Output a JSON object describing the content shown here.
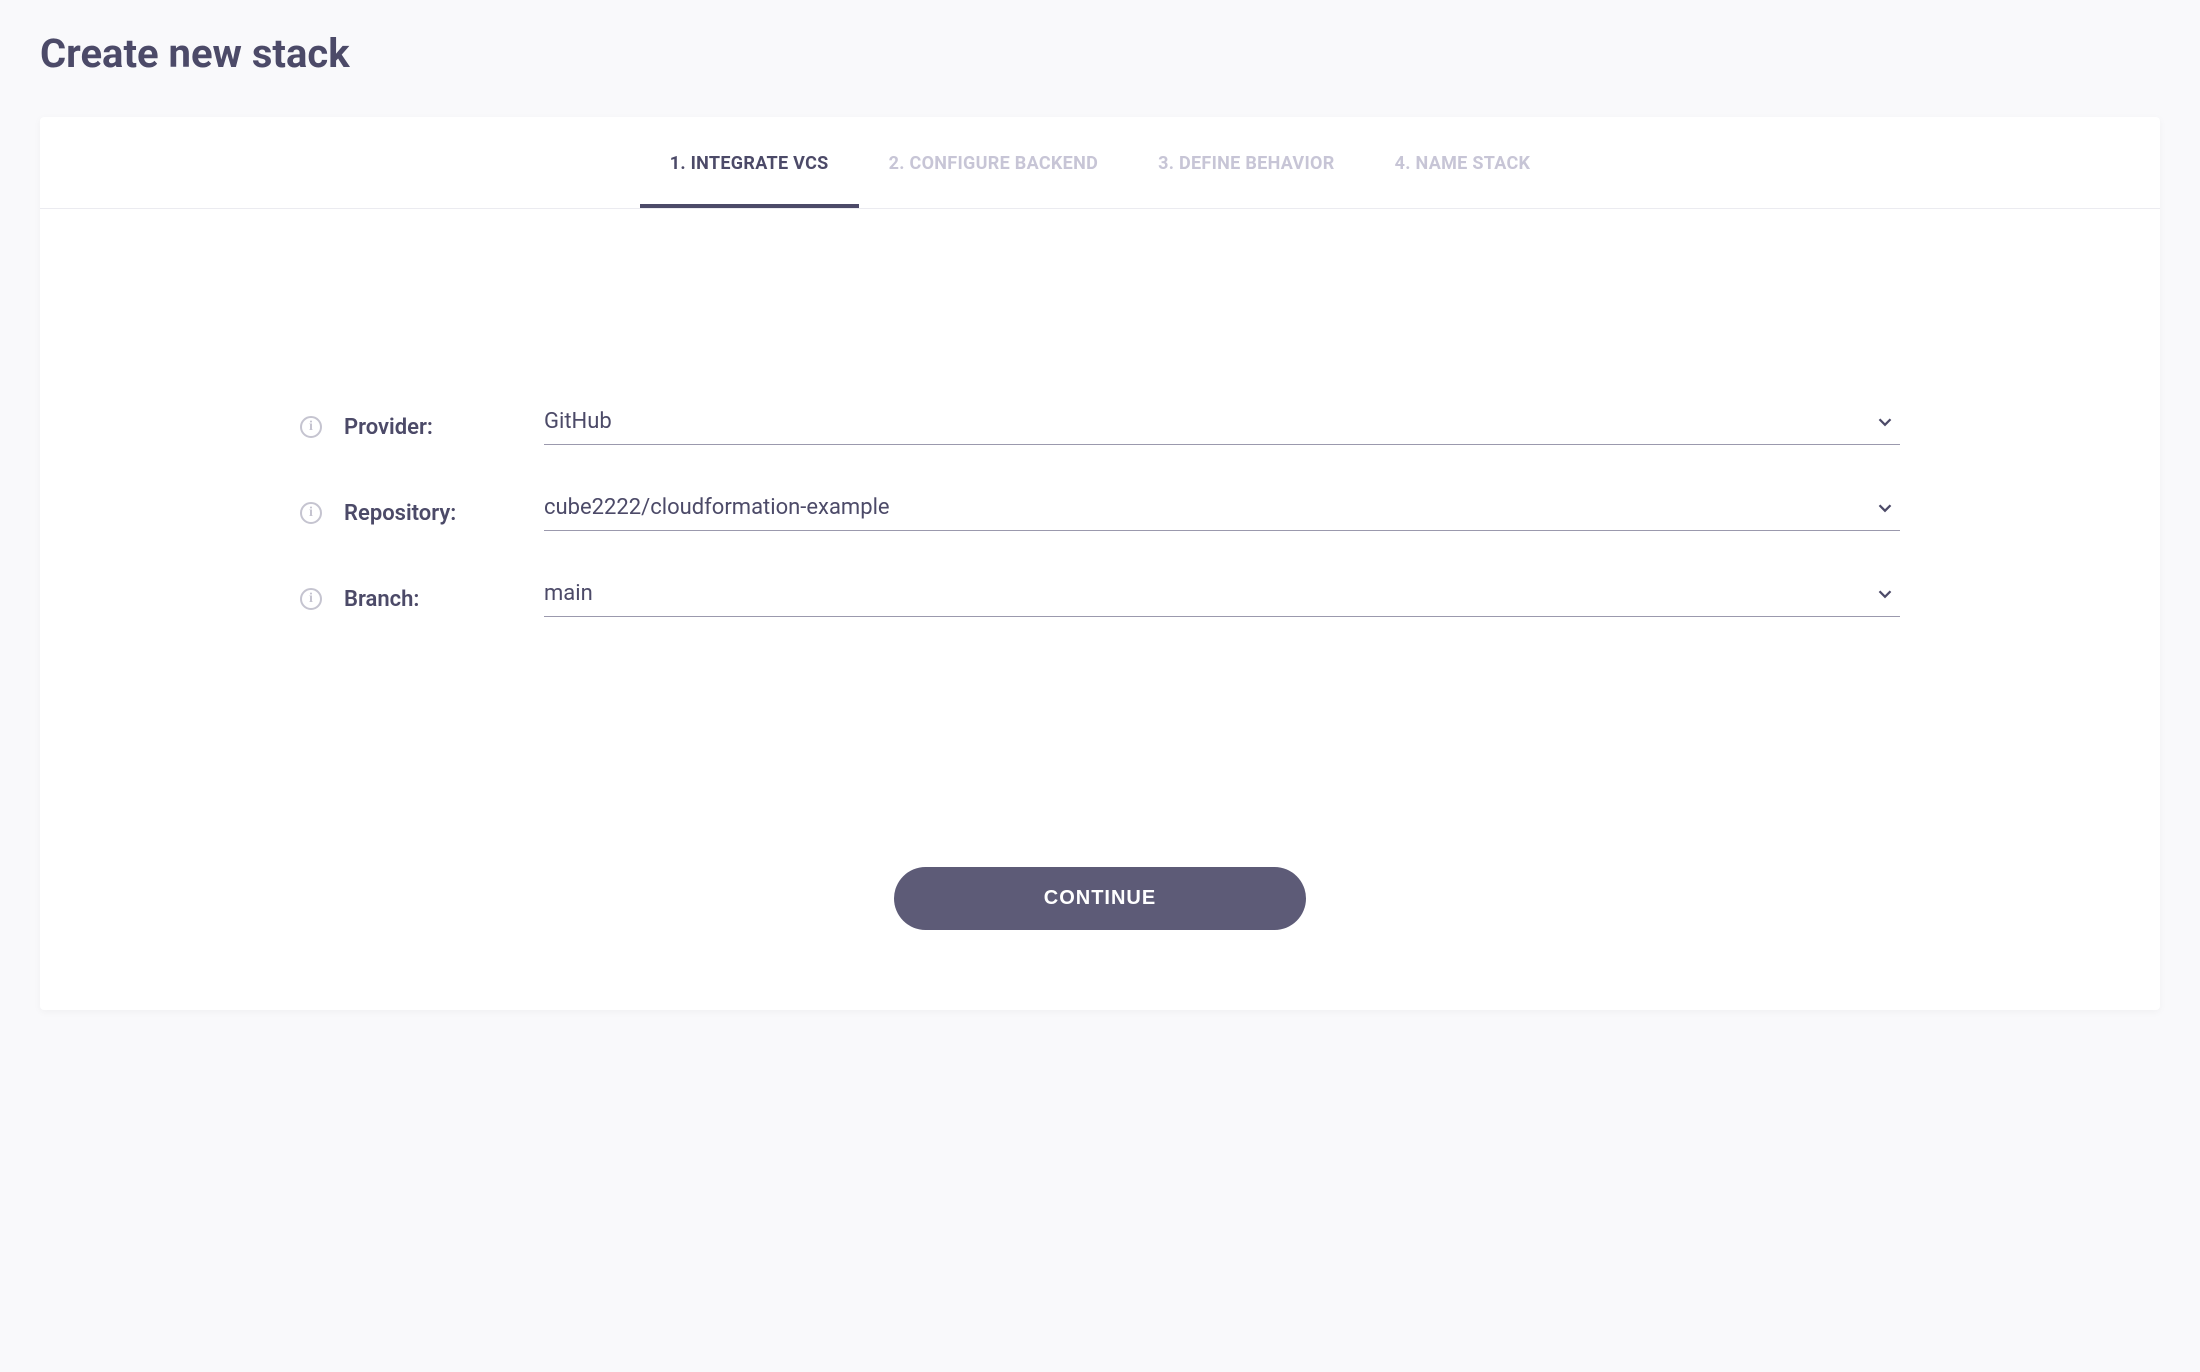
{
  "page": {
    "title": "Create new stack"
  },
  "tabs": [
    {
      "label": "1. INTEGRATE VCS",
      "active": true
    },
    {
      "label": "2. CONFIGURE BACKEND",
      "active": false
    },
    {
      "label": "3. DEFINE BEHAVIOR",
      "active": false
    },
    {
      "label": "4. NAME STACK",
      "active": false
    }
  ],
  "form": {
    "provider": {
      "label": "Provider:",
      "value": "GitHub"
    },
    "repository": {
      "label": "Repository:",
      "value": "cube2222/cloudformation-example"
    },
    "branch": {
      "label": "Branch:",
      "value": "main"
    }
  },
  "actions": {
    "continue": "CONTINUE"
  }
}
